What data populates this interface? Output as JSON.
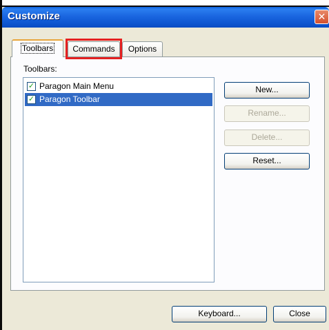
{
  "window": {
    "title": "Customize",
    "close_glyph": "✕"
  },
  "tabs": [
    {
      "label": "Toolbars",
      "active": true
    },
    {
      "label": "Commands",
      "active": false
    },
    {
      "label": "Options",
      "active": false
    }
  ],
  "toolbars": {
    "label": "Toolbars:",
    "items": [
      {
        "label": "Paragon Main Menu",
        "checked": true,
        "selected": false
      },
      {
        "label": "Paragon Toolbar",
        "checked": true,
        "selected": true
      }
    ]
  },
  "side_buttons": {
    "new": "New...",
    "rename": "Rename...",
    "delete": "Delete...",
    "reset": "Reset..."
  },
  "footer": {
    "keyboard": "Keyboard...",
    "close": "Close"
  },
  "check_glyph": "✓",
  "colors": {
    "highlight": "#e52020",
    "selection": "#316ac5",
    "titlebar": "#0a5fd8"
  }
}
